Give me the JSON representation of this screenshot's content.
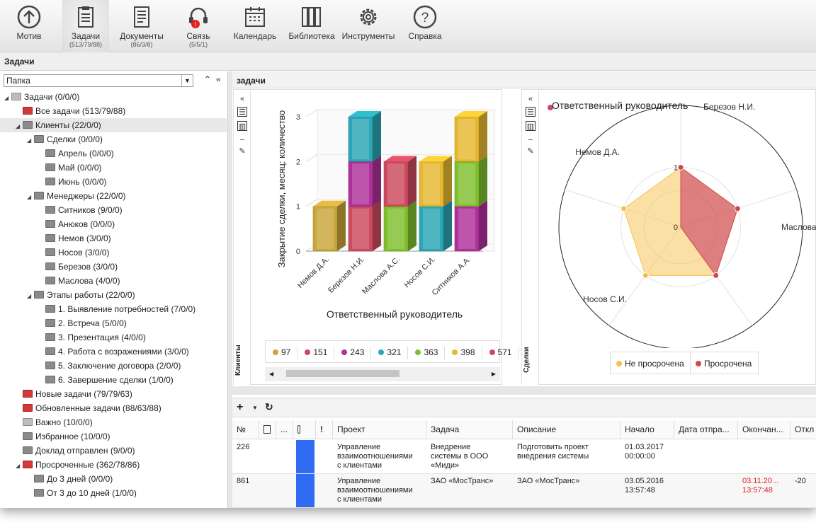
{
  "toolbar": {
    "items": [
      {
        "label": "Мотив",
        "count": ""
      },
      {
        "label": "Задачи",
        "count": "(513/79/88)"
      },
      {
        "label": "Документы",
        "count": "(86/3/8)"
      },
      {
        "label": "Связь",
        "count": "(5/5/1)"
      },
      {
        "label": "Календарь",
        "count": ""
      },
      {
        "label": "Библиотека",
        "count": ""
      },
      {
        "label": "Инструменты",
        "count": ""
      },
      {
        "label": "Справка",
        "count": ""
      }
    ]
  },
  "breadcrumb": "Задачи",
  "sidebar": {
    "folder_select": "Папка",
    "tree": [
      {
        "label": "Задачи (0/0/0)"
      },
      {
        "label": "Все задачи (513/79/88)"
      },
      {
        "label": "Клиенты (22/0/0)"
      },
      {
        "label": "Сделки (0/0/0)"
      },
      {
        "label": "Апрель (0/0/0)"
      },
      {
        "label": "Май (0/0/0)"
      },
      {
        "label": "Июнь (0/0/0)"
      },
      {
        "label": "Менеджеры (22/0/0)"
      },
      {
        "label": "Ситников (9/0/0)"
      },
      {
        "label": "Анюков (0/0/0)"
      },
      {
        "label": "Немов (3/0/0)"
      },
      {
        "label": "Носов (3/0/0)"
      },
      {
        "label": "Березов (3/0/0)"
      },
      {
        "label": "Маслова (4/0/0)"
      },
      {
        "label": "Этапы работы (22/0/0)"
      },
      {
        "label": "1. Выявление потребностей (7/0/0)"
      },
      {
        "label": "2. Встреча (5/0/0)"
      },
      {
        "label": "3. Презентация (4/0/0)"
      },
      {
        "label": "4. Работа с возражениями (3/0/0)"
      },
      {
        "label": "5. Заключение договора (2/0/0)"
      },
      {
        "label": "6. Завершение сделки (1/0/0)"
      },
      {
        "label": "Новые задачи (79/79/63)"
      },
      {
        "label": "Обновленные задачи (88/63/88)"
      },
      {
        "label": "Важно (10/0/0)"
      },
      {
        "label": "Избранное (10/0/0)"
      },
      {
        "label": "Доклад отправлен (9/0/0)"
      },
      {
        "label": "Просроченные (362/78/86)"
      },
      {
        "label": "До 3 дней (0/0/0)"
      },
      {
        "label": "От 3 до 10 дней (1/0/0)"
      }
    ]
  },
  "main": {
    "title": "задачи",
    "left_panel_label": "Клиенты",
    "right_panel_label": "Сделки"
  },
  "chart_data": [
    {
      "type": "bar",
      "stacked": true,
      "categories": [
        "Немов Д.А.",
        "Березов Н.И.",
        "Маслова А.С.",
        "Носов С.И.",
        "Ситников А.А."
      ],
      "series": [
        {
          "name": "97",
          "color": "#c9a53a",
          "values": [
            1,
            0,
            0,
            0,
            0
          ]
        },
        {
          "name": "151",
          "color": "#cc4a5e",
          "values": [
            0,
            1,
            0,
            0,
            0
          ]
        },
        {
          "name": "243",
          "color": "#b0309a",
          "values": [
            0,
            1,
            0,
            0,
            1
          ]
        },
        {
          "name": "321",
          "color": "#2aa6b4",
          "values": [
            0,
            1,
            0,
            1,
            0
          ]
        },
        {
          "name": "363",
          "color": "#7fbf2e",
          "values": [
            0,
            0,
            1,
            0,
            1
          ]
        },
        {
          "name": "398",
          "color": "#e6b830",
          "values": [
            0,
            0,
            0,
            1,
            1
          ]
        },
        {
          "name": "571",
          "color": "#cc4a5e",
          "values": [
            0,
            0,
            1,
            0,
            0
          ]
        }
      ],
      "xlabel": "Ответственный руководитель",
      "ylabel": "Закрытие сделки, месяц: количество",
      "ylim": [
        0,
        3
      ],
      "yticks": [
        "0",
        "1",
        "2",
        "3"
      ],
      "legend_position": "bottom"
    },
    {
      "type": "radar",
      "title": "Ответственный руководитель",
      "categories": [
        "Березов Н.И.",
        "Маслова",
        "Носов С.И.",
        "Немов Д.А."
      ],
      "ticks": [
        "0",
        "1"
      ],
      "series": [
        {
          "name": "Не просрочена",
          "color": "#f5c14a",
          "values": [
            1,
            0,
            1,
            1,
            1
          ]
        },
        {
          "name": "Просрочена",
          "color": "#d04848",
          "values": [
            1,
            1,
            1,
            0,
            0
          ]
        }
      ],
      "legend_position": "bottom"
    }
  ],
  "grid": {
    "headers": [
      "№",
      "",
      "...",
      "",
      "!",
      "Проект",
      "Задача",
      "Описание",
      "Начало",
      "Дата отпра...",
      "Окончан...",
      "Откл"
    ],
    "rows": [
      {
        "num": "226",
        "project": "Управление\nвзаимоотношениями\nс клиентами",
        "task": "Внедрение\nсистемы в ООО\n«Миди»",
        "desc": "Подготовить проект\nвнедрения системы",
        "start": "01.03.2017\n00:00:00",
        "sent": "",
        "end": "",
        "dev": ""
      },
      {
        "num": "861",
        "project": "Управление\nвзаимоотношениями\nс клиентами",
        "task": "ЗАО «МосТранс»",
        "desc": "ЗАО «МосТранс»",
        "start": "03.05.2016\n13:57:48",
        "sent": "",
        "end": "03.11.20...\n13:57:48",
        "dev": "-20"
      }
    ]
  }
}
